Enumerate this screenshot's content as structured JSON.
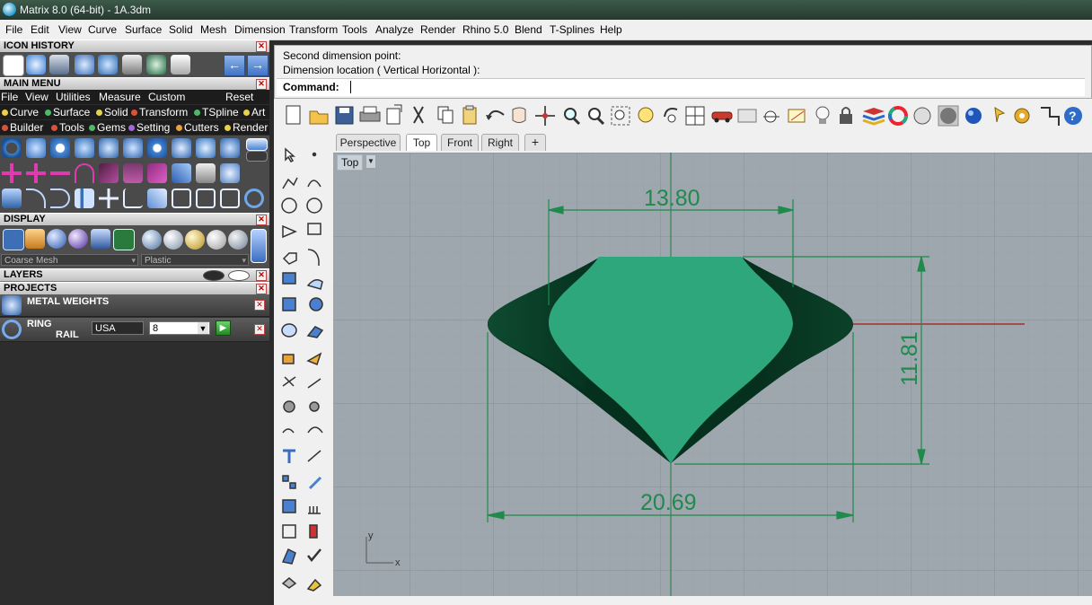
{
  "window": {
    "title": "Matrix 8.0 (64-bit) - 1A.3dm"
  },
  "menubar": [
    "File",
    "Edit",
    "View",
    "Curve",
    "Surface",
    "Solid",
    "Mesh",
    "Dimension",
    "Transform",
    "Tools",
    "Analyze",
    "Render",
    "Rhino 5.0",
    "Blend",
    "T-Splines",
    "Help"
  ],
  "left_panel": {
    "icon_history": {
      "title": "ICON HISTORY"
    },
    "main_menu": {
      "title": "MAIN MENU",
      "items": [
        "File",
        "View",
        "Utilities",
        "Measure",
        "Custom"
      ],
      "reset": "Reset",
      "categories_row1": [
        {
          "label": "Curve",
          "color": "#e8d24a"
        },
        {
          "label": "Surface",
          "color": "#4fb86a"
        },
        {
          "label": "Solid",
          "color": "#e8d24a"
        },
        {
          "label": "Transform",
          "color": "#d9533b"
        },
        {
          "label": "TSpline",
          "color": "#4fb86a"
        },
        {
          "label": "Art",
          "color": "#e8d24a"
        }
      ],
      "categories_row2": [
        {
          "label": "Builder",
          "color": "#d9533b"
        },
        {
          "label": "Tools",
          "color": "#d9533b"
        },
        {
          "label": "Gems",
          "color": "#4fb86a"
        },
        {
          "label": "Setting",
          "color": "#a368d8"
        },
        {
          "label": "Cutters",
          "color": "#e8a23a"
        },
        {
          "label": "Render",
          "color": "#e8d24a"
        }
      ]
    },
    "display": {
      "title": "DISPLAY",
      "mesh_quality": "Coarse Mesh",
      "material": "Plastic"
    },
    "layers": {
      "title": "LAYERS"
    },
    "projects": {
      "title": "PROJECTS"
    },
    "metal_weights": {
      "label": "METAL WEIGHTS"
    },
    "ring_rail": {
      "label_line1": "RING",
      "label_line2": "RAIL",
      "region": "USA",
      "size": "8"
    }
  },
  "command": {
    "history": [
      "Second dimension point:",
      "Dimension location ( Vertical  Horizontal ):"
    ],
    "prompt": "Command:"
  },
  "viewport_tabs": [
    "Perspective",
    "Top",
    "Front",
    "Right"
  ],
  "active_tab": "Top",
  "viewport": {
    "name": "Top",
    "dimensions": {
      "top_width": "13.80",
      "height": "11.81",
      "bottom_width": "20.69"
    },
    "axis": {
      "x": "x",
      "y": "y"
    },
    "colors": {
      "gem_top": "#2ea77d",
      "gem_edge": "#063a25",
      "dimension": "#1f8a4c",
      "background": "#9da5ae",
      "grid": "#8f979f",
      "x_axis": "#a0302c"
    }
  }
}
